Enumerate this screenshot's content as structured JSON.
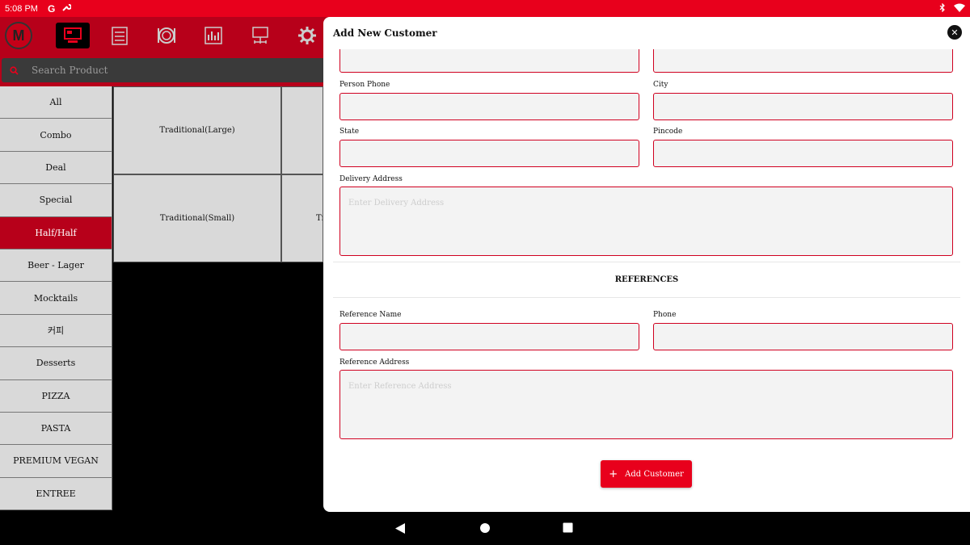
{
  "status_bar": {
    "time": "5:08 PM"
  },
  "search": {
    "placeholder": "Search Product"
  },
  "categories": [
    "All",
    "Combo",
    "Deal",
    "Special",
    "Half/Half",
    "Beer - Lager",
    "Mocktails",
    "커피",
    "Desserts",
    "PIZZA",
    "PASTA",
    "PREMIUM VEGAN",
    "ENTREE"
  ],
  "active_category": "Half/Half",
  "products": [
    {
      "name": "Traditional(Large)",
      "partial": ""
    },
    {
      "name": "Traditional(Small)",
      "partial": "Tr"
    }
  ],
  "modal": {
    "title": "Add New Customer",
    "fields": {
      "person_phone": "Person Phone",
      "city": "City",
      "state": "State",
      "pincode": "Pincode",
      "delivery_address": "Delivery Address",
      "delivery_placeholder": "Enter Delivery Address",
      "references_heading": "REFERENCES",
      "reference_name": "Reference Name",
      "phone": "Phone",
      "reference_address": "Reference Address",
      "reference_placeholder": "Enter Reference Address"
    },
    "submit_label": "Add Customer"
  },
  "colors": {
    "accent": "#e8001c",
    "toolbar": "#b7001a"
  }
}
